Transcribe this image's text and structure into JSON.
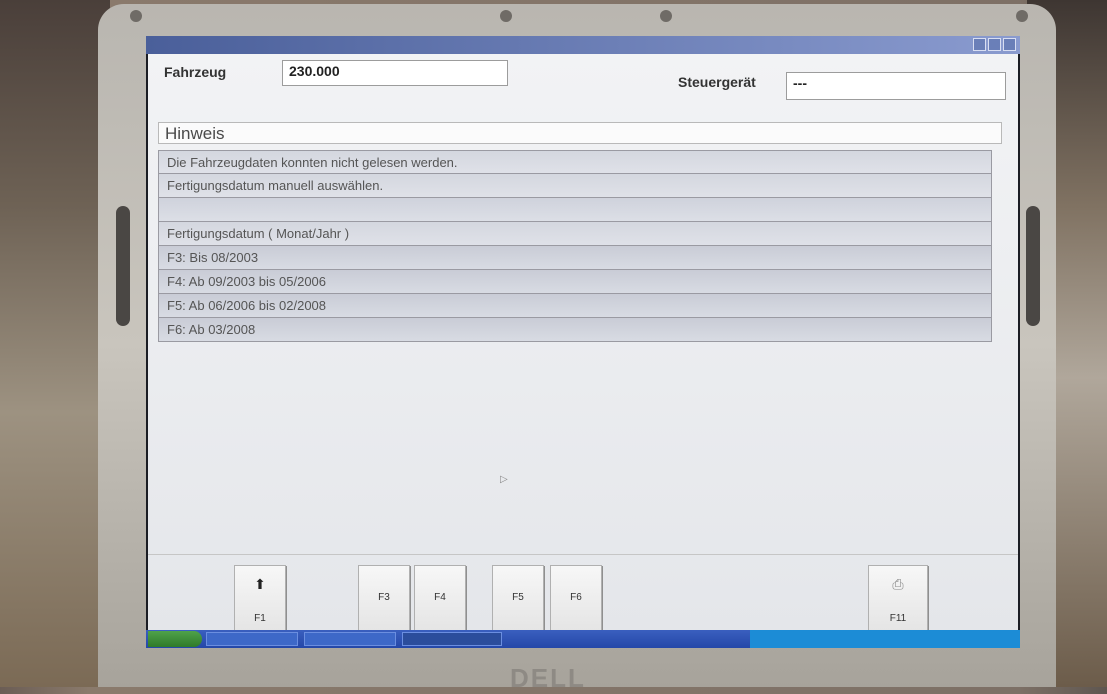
{
  "header": {
    "fahrzeug_label": "Fahrzeug",
    "fahrzeug_value": "230.000",
    "steuergeraet_label": "Steuergerät",
    "steuergeraet_value": "---"
  },
  "hinweis": "Hinweis",
  "messages": [
    "Die Fahrzeugdaten konnten nicht gelesen werden.",
    "Fertigungsdatum manuell auswählen.",
    "",
    "Fertigungsdatum ( Monat/Jahr )",
    "F3: Bis 08/2003",
    "F4: Ab 09/2003 bis 05/2006",
    "F5: Ab 06/2006 bis 02/2008",
    "F6: Ab 03/2008"
  ],
  "function_keys": {
    "f1": "F1",
    "f3": "F3",
    "f4": "F4",
    "f5": "F5",
    "f6": "F6",
    "f11": "F11"
  },
  "icons": {
    "f1": "arrow-up-icon",
    "f11": "print-icon"
  },
  "bezel": {
    "brand": "DELL"
  },
  "colors": {
    "app_background": "#eceef1",
    "list_row": "#d8dbe2",
    "taskbar": "#2447a8"
  }
}
